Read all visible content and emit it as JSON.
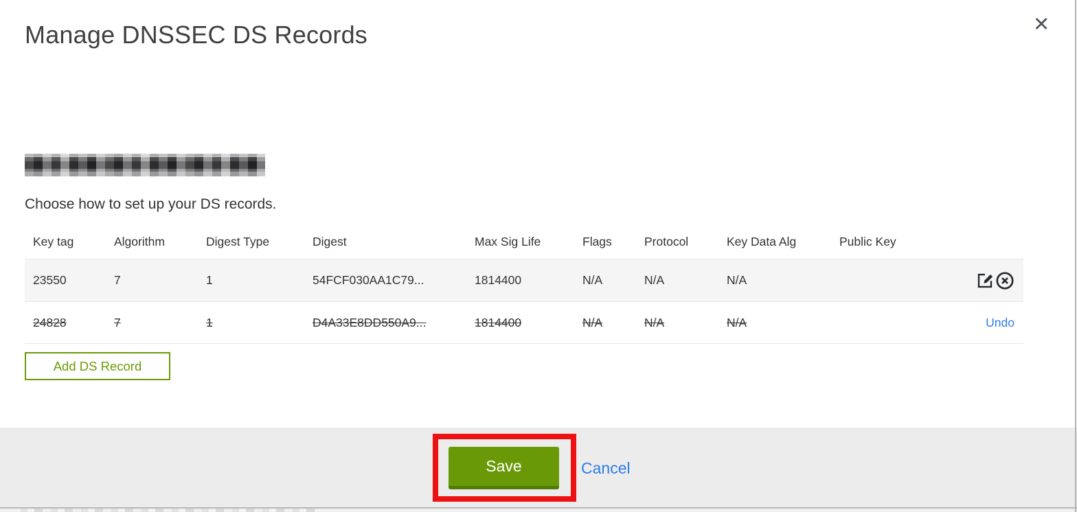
{
  "modal": {
    "title": "Manage DNSSEC DS Records",
    "close_glyph": "✕",
    "subtitle": "Choose how to set up your DS records.",
    "table": {
      "columns": [
        "Key tag",
        "Algorithm",
        "Digest Type",
        "Digest",
        "Max Sig Life",
        "Flags",
        "Protocol",
        "Key Data Alg",
        "Public Key"
      ],
      "rows": [
        {
          "key_tag": "23550",
          "algorithm": "7",
          "digest_type": "1",
          "digest": "54FCF030AA1C79...",
          "max_sig_life": "1814400",
          "flags": "N/A",
          "protocol": "N/A",
          "key_data_alg": "N/A",
          "public_key": "",
          "state": "active"
        },
        {
          "key_tag": "24828",
          "algorithm": "7",
          "digest_type": "1",
          "digest": "D4A33E8DD550A9...",
          "max_sig_life": "1814400",
          "flags": "N/A",
          "protocol": "N/A",
          "key_data_alg": "N/A",
          "public_key": "",
          "state": "deleted",
          "undo_label": "Undo"
        }
      ]
    },
    "add_button_label": "Add DS Record",
    "footer": {
      "save_label": "Save",
      "cancel_label": "Cancel"
    }
  },
  "colors": {
    "accent_green": "#6a9908",
    "green_border": "#6b9b05",
    "link_blue": "#2d7ce9",
    "annotation_red": "#ee1111",
    "footer_gray": "#ececec",
    "row_stripe_gray": "#f5f5f5"
  }
}
